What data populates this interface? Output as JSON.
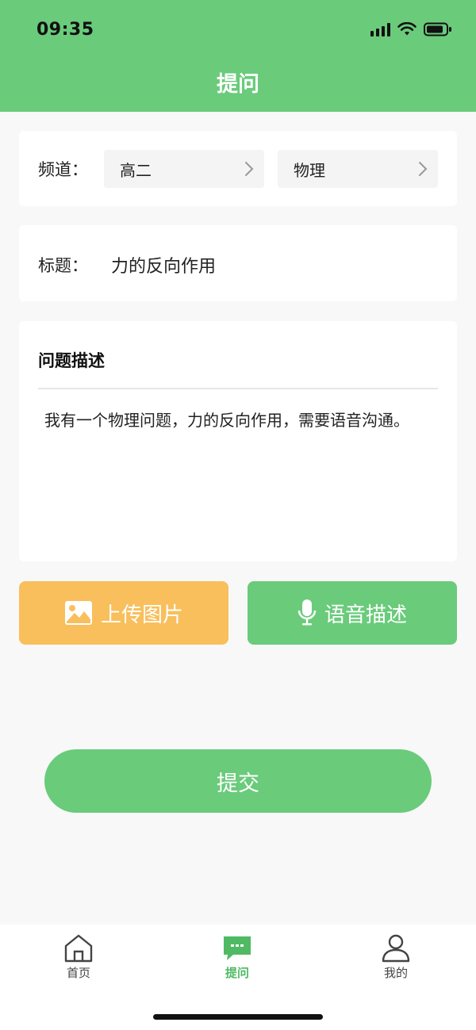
{
  "status_bar": {
    "time": "09:35"
  },
  "header": {
    "title": "提问"
  },
  "channel": {
    "label": "频道：",
    "grade": "高二",
    "subject": "物理"
  },
  "title_field": {
    "label": "标题：",
    "value": "力的反向作用"
  },
  "description": {
    "heading": "问题描述",
    "text": "我有一个物理问题，力的反向作用，需要语音沟通。"
  },
  "actions": {
    "upload_label": "上传图片",
    "voice_label": "语音描述"
  },
  "submit_label": "提交",
  "tabbar": {
    "items": [
      {
        "label": "首页",
        "icon": "home-icon"
      },
      {
        "label": "提问",
        "icon": "chat-icon",
        "active": true
      },
      {
        "label": "我的",
        "icon": "user-icon"
      }
    ]
  },
  "colors": {
    "primary_green": "#6acb7b",
    "upload_orange": "#f8bf5c",
    "active_tab": "#4fba63"
  }
}
